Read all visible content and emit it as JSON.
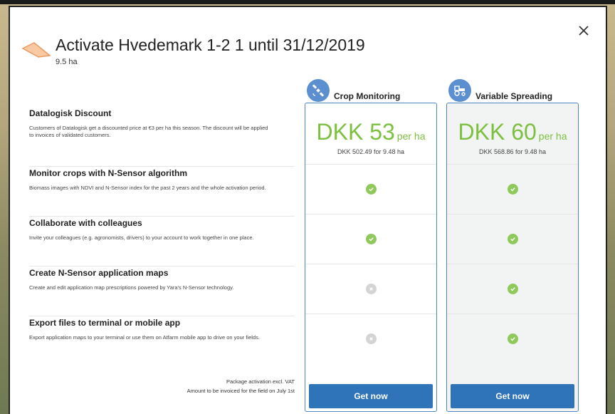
{
  "modal": {
    "title": "Activate Hvedemark 1-2 1 until 31/12/2019",
    "subtitle": "9.5 ha",
    "close_icon": "close-icon",
    "field_icon": "field-shape-icon"
  },
  "features": [
    {
      "title": "Datalogisk Discount",
      "description": "Customers of Datalogisk get a discounted price at €3 per ha this season. The discount will be applied\nto invoices of validated customers."
    },
    {
      "title": "Monitor crops with N-Sensor algorithm",
      "description": "Biomass images with NDVI and N-Sensor index for the past 2 years and the whole activation period."
    },
    {
      "title": "Collaborate with colleagues",
      "description": "Invite your colleagues (e.g. agronomists, drivers) to your account to work together in one place."
    },
    {
      "title": "Create N-Sensor application maps",
      "description": "Create and edit application map prescriptions powered by Yara's N-Sensor technology."
    },
    {
      "title": "Export files to terminal or mobile app",
      "description": "Export application maps to your terminal or use them on Atfarm mobile app to drive on your fields."
    }
  ],
  "footnote": {
    "line1": "Package activation excl. VAT",
    "line2": "Amount to be invoiced for the field on July 1st"
  },
  "plans": [
    {
      "name": "Crop Monitoring",
      "icon": "satellite-icon",
      "price": "DKK 53",
      "unit": "per ha",
      "price_detail": "DKK 502.49 for 9.48 ha",
      "features": [
        true,
        true,
        false,
        false
      ],
      "button": "Get now"
    },
    {
      "name": "Variable Spreading",
      "icon": "tractor-icon",
      "price": "DKK 60",
      "unit": "per ha",
      "price_detail": "DKK 568.86 for 9.48 ha",
      "features": [
        true,
        true,
        true,
        true
      ],
      "button": "Get now"
    }
  ],
  "colors": {
    "accent_blue": "#2f73b8",
    "price_green": "#7dbf3f",
    "check_green": "#8fc95b",
    "cross_grey": "#d4d4d4",
    "icon_blue": "#5b8fd0"
  }
}
